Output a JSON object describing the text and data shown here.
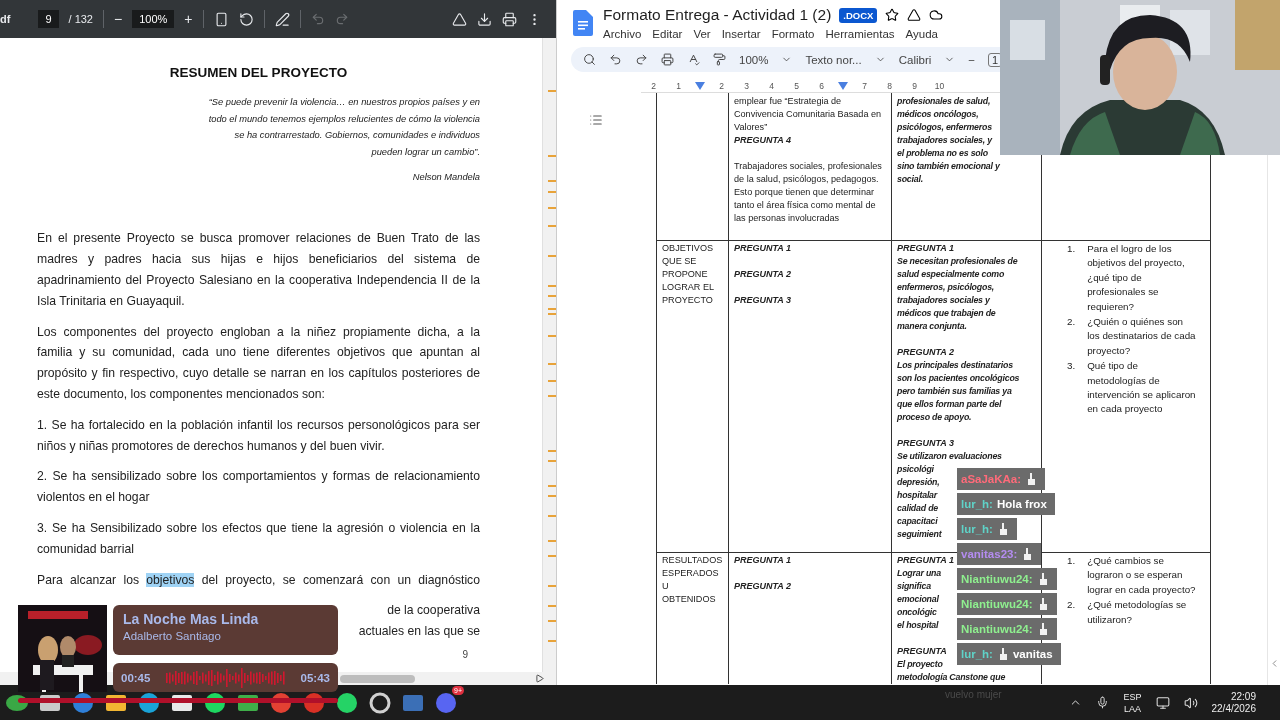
{
  "pdf_viewer": {
    "file_label": "df",
    "page": "9",
    "page_total": "/ 132",
    "zoom_out": "−",
    "zoom": "100%",
    "zoom_in": "+",
    "undo": {
      "disabled": true
    },
    "redo": {
      "disabled": true
    }
  },
  "pdf_page": {
    "title": "RESUMEN DEL PROYECTO",
    "quote": [
      "“Se puede prevenir la violencia… en nuestros propios países y en",
      "todo el mundo tenemos ejemplos relucientes de cómo la violencia",
      "se ha contrarrestado. Gobiernos, comunidades e individuos",
      "pueden lograr un cambio”."
    ],
    "quote_author": "Nelson Mandela",
    "paragraphs": [
      {
        "parts": [
          {
            "text": "En el presente Proyecto se busca promover relaciones de Buen Trato de las madres y padres hacia sus hijas e hijos beneficiarios del sistema de apadrinamiento del Proyecto Salesiano en la cooperativa Independencia II de la Isla Trinitaria en Guayaquil.",
            "highlighted": false
          }
        ]
      },
      {
        "parts": [
          {
            "text": "Los componentes del proyecto engloban a la niñez propiamente dicha, a la familia y su comunidad, cada uno tiene diferentes objetivos que apuntan al propósito y fin respectivo, cuyo detalle se narran en los capítulos posteriores de este documento, los componentes mencionados son:",
            "highlighted": false
          }
        ]
      },
      {
        "parts": [
          {
            "text": "1. Se ha fortalecido en la población infantil los recursos personológicos para ser niños y niñas promotores de derechos humanos y del buen vivir.",
            "highlighted": false
          }
        ]
      },
      {
        "parts": [
          {
            "text": "2. Se ha sensibilizado sobre los comportamientos y formas de relacionamiento violentos en el hogar",
            "highlighted": false
          }
        ]
      },
      {
        "parts": [
          {
            "text": "3. Se ha Sensibilizado sobre los efectos que tiene la agresión o violencia en la comunidad barrial",
            "highlighted": false
          }
        ]
      },
      {
        "parts": [
          {
            "text": "Para alcanzar los ",
            "highlighted": false
          },
          {
            "text": "objetivos",
            "highlighted": true
          },
          {
            "text": " del proyecto, se comenzará con un diagnóstico",
            "highlighted": false
          }
        ]
      }
    ],
    "cut_lines": [
      "de la cooperativa",
      "actuales en las que se"
    ],
    "page_number": "9"
  },
  "docs": {
    "title": "Formato Entrega - Actividad 1 (2)",
    "badge": ".DOCX",
    "menu": [
      "Archivo",
      "Editar",
      "Ver",
      "Insertar",
      "Formato",
      "Herramientas",
      "Ayuda"
    ],
    "toolbar": {
      "zoom": "100%",
      "style": "Texto nor...",
      "font": "Calibri",
      "size_minus": "−",
      "size": "1"
    },
    "ruler": [
      "2",
      "1",
      "2",
      "3",
      "4",
      "5",
      "6",
      "7",
      "8",
      "9",
      "10"
    ],
    "table": {
      "rows": [
        {
          "cells": [
            [],
            [
              {
                "kind": "plain",
                "text": "emplear fue “Estrategia de Convivencia Comunitaria Basada en Valores”"
              },
              {
                "kind": "question",
                "text": "PREGUNTA 4"
              },
              {
                "kind": "gap"
              },
              {
                "kind": "plain",
                "text": "Trabajadores sociales, profesionales de la salud, psicólogos, pedagogos. Esto porque tienen que determinar tanto el área física como mental de las personas involucradas"
              }
            ],
            [
              {
                "kind": "lines",
                "lines": [
                  "profesionales de salud,",
                  "médicos oncólogos,",
                  "psicólogos, enfermeros",
                  "trabajadores sociales, y",
                  "el problema no es solo",
                  "sino también emocional y",
                  "social."
                ]
              }
            ],
            []
          ]
        },
        {
          "cells": [
            [
              {
                "kind": "plain",
                "text": "OBJETIVOS QUE SE PROPONE LOGRAR EL PROYECTO"
              }
            ],
            [
              {
                "kind": "question",
                "text": "PREGUNTA 1"
              },
              {
                "kind": "gap"
              },
              {
                "kind": "question",
                "text": "PREGUNTA 2"
              },
              {
                "kind": "gap"
              },
              {
                "kind": "question",
                "text": "PREGUNTA 3"
              }
            ],
            [
              {
                "kind": "question",
                "text": "PREGUNTA 1"
              },
              {
                "kind": "lines",
                "lines": [
                  "Se necesitan profesionales de",
                  "salud especialmente como",
                  "enfermeros, psicólogos,",
                  "trabajadores sociales y",
                  "médicos que trabajen de",
                  "manera conjunta."
                ]
              },
              {
                "kind": "gap"
              },
              {
                "kind": "question",
                "text": "PREGUNTA 2"
              },
              {
                "kind": "lines",
                "lines": [
                  "Los principales destinatarios",
                  "son los pacientes oncológicos",
                  "pero también sus familias ya",
                  "que ellos forman parte del",
                  "proceso de apoyo."
                ]
              },
              {
                "kind": "gap"
              },
              {
                "kind": "question",
                "text": "PREGUNTA 3"
              },
              {
                "kind": "lines",
                "lines": [
                  "Se utilizaron evaluaciones"
                ]
              },
              {
                "kind": "lines",
                "lines": [
                  "psicológi",
                  "depresión,",
                  "hospitalar",
                  "calidad de",
                  "capacitaci",
                  "seguimient"
                ]
              }
            ],
            [
              {
                "kind": "list",
                "items": [
                  {
                    "number": "1.",
                    "text": "Para el logro de los objetivos del proyecto, ¿qué tipo de profesionales se requieren?"
                  },
                  {
                    "number": "2.",
                    "text": "¿Quién o quiénes son los destinatarios de cada proyecto?"
                  },
                  {
                    "number": "3.",
                    "text": "Qué tipo de metodologías de intervención se aplicaron en cada proyecto"
                  }
                ]
              }
            ]
          ]
        },
        {
          "cells": [
            [
              {
                "kind": "plain",
                "text": "RESULTADOS ESPERADOS U OBTENIDOS"
              }
            ],
            [
              {
                "kind": "question",
                "text": "PREGUNTA 1"
              },
              {
                "kind": "gap"
              },
              {
                "kind": "question",
                "text": "PREGUNTA 2"
              }
            ],
            [
              {
                "kind": "question",
                "text": "PREGUNTA 1"
              },
              {
                "kind": "lines",
                "lines": [
                  "Lograr una",
                  "significa",
                  "emocional",
                  "oncológic",
                  "el hospital"
                ]
              },
              {
                "kind": "gap"
              },
              {
                "kind": "question",
                "text": "PREGUNTA"
              },
              {
                "kind": "lines",
                "lines": [
                  "El proyecto",
                  "metodología Canstone que"
                ]
              }
            ],
            [
              {
                "kind": "list",
                "items": [
                  {
                    "number": "1.",
                    "text": "¿Qué cambios se lograron o se esperan lograr en cada proyecto?"
                  },
                  {
                    "number": "2.",
                    "text": "¿Qué metodologías se utilizaron?"
                  }
                ]
              }
            ]
          ]
        }
      ]
    }
  },
  "chat": [
    {
      "user": "aSaJaKAa:",
      "color": "#ff6b7a",
      "emote": true
    },
    {
      "user": "lur_h:",
      "color": "#5fd3c8",
      "message": "Hola frox",
      "emote": false
    },
    {
      "user": "lur_h:",
      "color": "#5fd3c8",
      "emote": true
    },
    {
      "user": "vanitas23:",
      "color": "#b48cf0",
      "emote": true
    },
    {
      "user": "Niantiuwu24:",
      "color": "#8ff08f",
      "emote": true
    },
    {
      "user": "Niantiuwu24:",
      "color": "#8ff08f",
      "emote": true
    },
    {
      "user": "Niantiuwu24:",
      "color": "#8ff08f",
      "emote": true
    },
    {
      "user": "lur_h:",
      "color": "#5fd3c8",
      "message": "vanitas",
      "emote": true
    }
  ],
  "music_player": {
    "title": "La Noche Mas Linda",
    "artist": "Adalberto Santiago",
    "elapsed": "00:45",
    "duration": "05:43"
  },
  "taskbar": {
    "discord_badge": "9+",
    "caption": "vuelvo mujer",
    "tray": {
      "language": "ESP",
      "layout": "LAA",
      "time": "22:09",
      "date": "22/4/2026"
    }
  }
}
